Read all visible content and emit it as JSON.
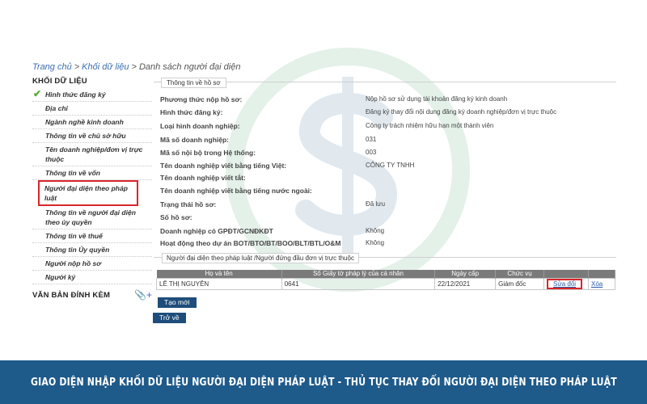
{
  "breadcrumb": {
    "home": "Trang chủ",
    "block": "Khối dữ liệu",
    "current": "Danh sách người đại diện",
    "sep": ">"
  },
  "sidebar": {
    "title": "KHỐI DỮ LIỆU",
    "items": [
      "Hình thức đăng ký",
      "Địa chỉ",
      "Ngành nghề kinh doanh",
      "Thông tin về chủ sở hữu",
      "Tên doanh nghiệp/đơn vị trực thuộc",
      "Thông tin về vốn",
      "Người đại diện theo pháp luật",
      "Thông tin về người đại diện theo ủy quyền",
      "Thông tin về thuế",
      "Thông tin Ủy quyền",
      "Người nộp hồ sơ",
      "Người ký"
    ],
    "attachments_title": "VĂN BẢN ĐÍNH KÈM",
    "attach_icon": "paperclip-plus-icon"
  },
  "info": {
    "legend": "Thông tin về hồ sơ",
    "rows": [
      {
        "label": "Phương thức nộp hồ sơ:",
        "value": "Nộp hồ sơ sử dụng tài khoản đăng ký kinh doanh"
      },
      {
        "label": "Hình thức đăng ký:",
        "value": "Đăng ký thay đổi nội dung đăng ký doanh nghiệp/đơn vị trực thuộc"
      },
      {
        "label": "Loại hình doanh nghiệp:",
        "value": "Công ty trách nhiệm hữu hạn một thành viên"
      },
      {
        "label": "Mã số doanh nghiệp:",
        "value": "031"
      },
      {
        "label": "Mã số nội bộ trong Hệ thống:",
        "value": "003"
      },
      {
        "label": "Tên doanh nghiệp viết bằng tiếng Việt:",
        "value": "CÔNG TY TNHH"
      },
      {
        "label": "Tên doanh nghiệp viết tắt:",
        "value": ""
      },
      {
        "label": "Tên doanh nghiệp viết bằng tiếng nước ngoài:",
        "value": ""
      },
      {
        "label": "Trạng thái hồ sơ:",
        "value": "Đã lưu"
      },
      {
        "label": "Số hồ sơ:",
        "value": ""
      },
      {
        "label": "Doanh nghiệp có GPĐT/GCNĐKĐT",
        "value": "Không"
      },
      {
        "label": "Hoạt động theo dự án BOT/BTO/BT/BOO/BLT/BTL/O&M",
        "value": "Không"
      }
    ]
  },
  "representatives": {
    "legend": "Người đại diện theo pháp luật /Người đứng đầu đơn vị trực thuộc",
    "headers": [
      "Họ và tên",
      "Số Giấy tờ pháp lý của cá nhân",
      "Ngày cấp",
      "Chức vụ",
      "",
      ""
    ],
    "rows": [
      {
        "name": "LÊ THỊ NGUYÊN",
        "id_no": "0641",
        "issue_date": "22/12/2021",
        "position": "Giám đốc",
        "edit": "Sửa đổi",
        "delete": "Xóa"
      }
    ]
  },
  "buttons": {
    "create": "Tạo mới",
    "back": "Trở về"
  },
  "footer": {
    "caption": "GIAO DIỆN NHẬP KHỐI DỮ LIỆU NGƯỜI ĐẠI DIỆN PHÁP LUẬT - THỦ TỤC THAY ĐỔI NGƯỜI ĐẠI DIỆN THEO PHÁP LUẬT"
  },
  "colors": {
    "footer_bg": "#1e5a8a",
    "button_bg": "#1e4d7b",
    "highlight": "#d9262b",
    "check": "#5aaa2b"
  }
}
